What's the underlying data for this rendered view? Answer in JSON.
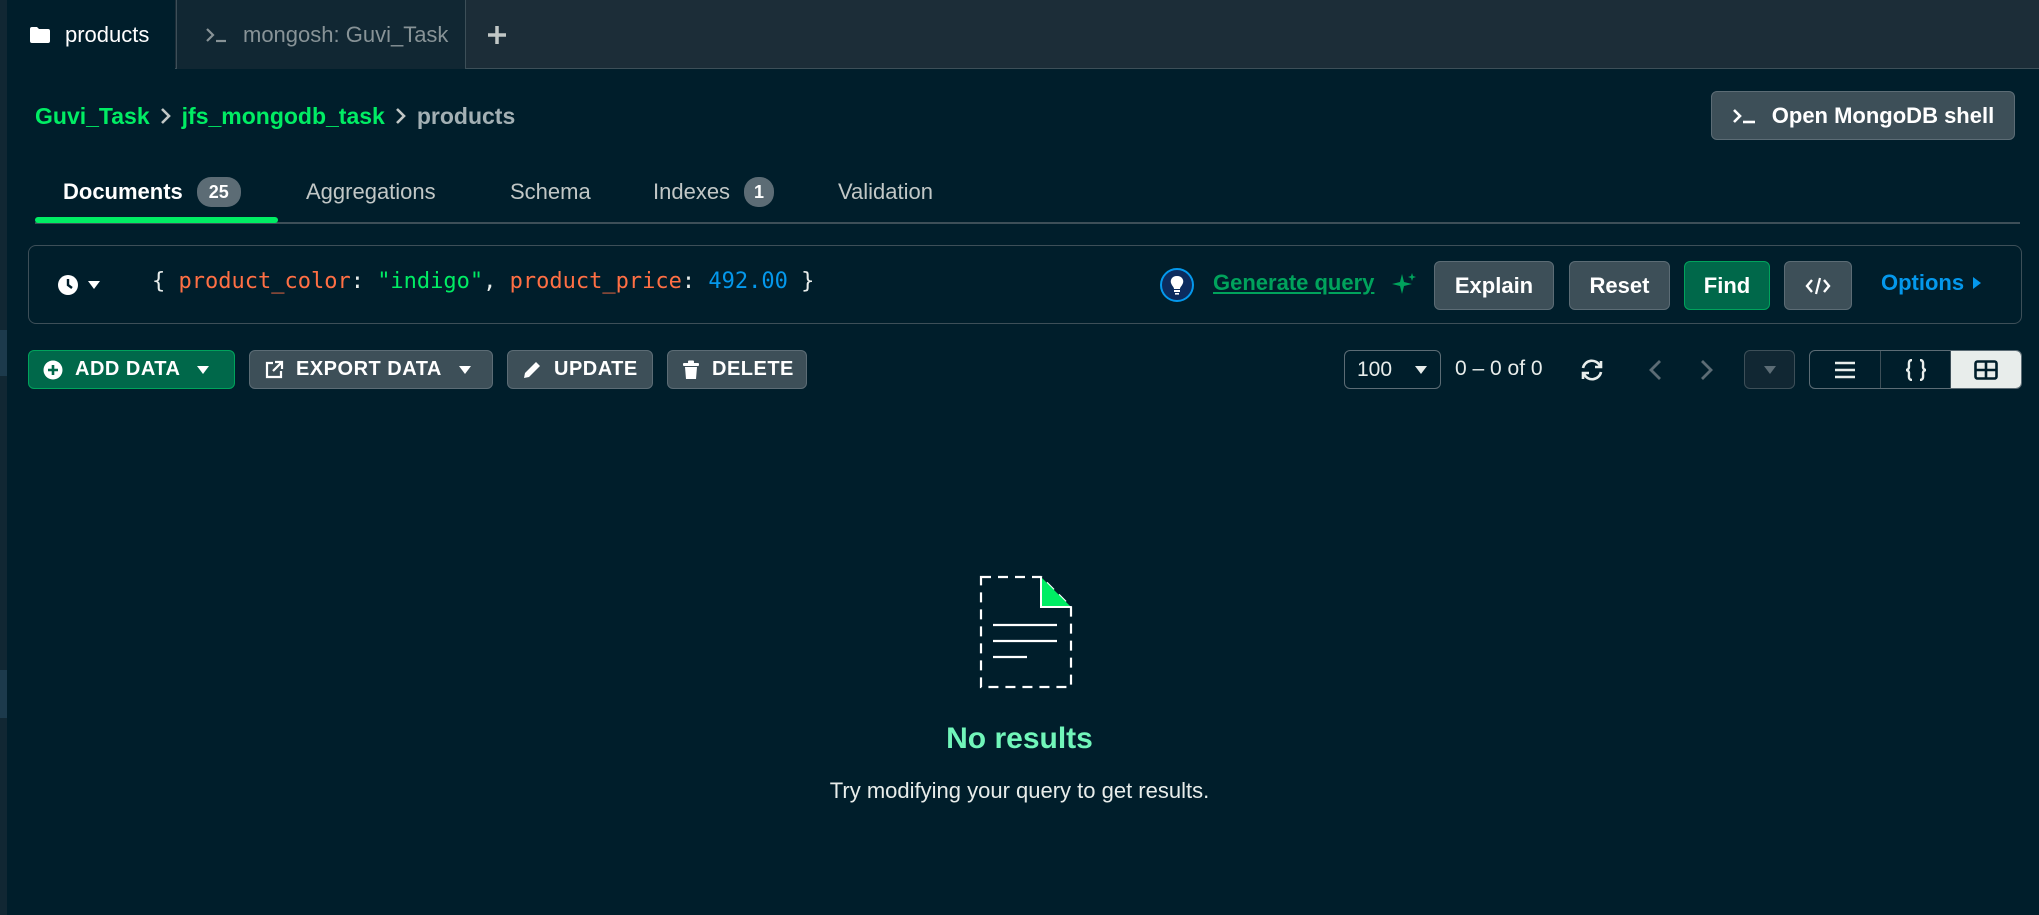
{
  "tabs": [
    {
      "label": "products",
      "icon": "folder-icon"
    },
    {
      "label": "mongosh: Guvi_Task",
      "icon": "terminal-icon"
    }
  ],
  "tab_add_icon": "plus-icon",
  "breadcrumb": {
    "cluster": "Guvi_Task",
    "database": "jfs_mongodb_task",
    "collection": "products"
  },
  "shell_button": {
    "label": "Open MongoDB shell",
    "icon": "terminal-icon"
  },
  "subtabs": [
    {
      "label": "Documents",
      "count": "25"
    },
    {
      "label": "Aggregations"
    },
    {
      "label": "Schema"
    },
    {
      "label": "Indexes",
      "count": "1"
    },
    {
      "label": "Validation"
    }
  ],
  "query": {
    "open": "{ ",
    "key1": "product_color",
    "colon1": ": ",
    "val1": "\"indigo\"",
    "comma": ", ",
    "key2": "product_price",
    "colon2": ": ",
    "val2": "492.00",
    "close": " }",
    "generate_label": "Generate query",
    "explain_label": "Explain",
    "reset_label": "Reset",
    "find_label": "Find",
    "options_label": "Options"
  },
  "toolbar": {
    "add_data": "ADD DATA",
    "export_data": "EXPORT DATA",
    "update": "UPDATE",
    "delete": "DELETE",
    "page_size": "100",
    "range": "0 – 0 of 0"
  },
  "empty_state": {
    "title": "No results",
    "description": "Try modifying your query to get results."
  },
  "colors": {
    "background": "#001e2b",
    "accent_green": "#00ed64",
    "find_button": "#00684a",
    "link_blue": "#0498ec"
  }
}
